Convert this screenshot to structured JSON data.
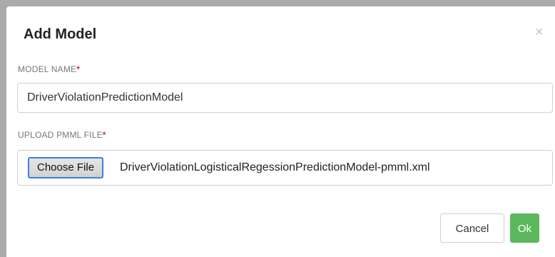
{
  "modal": {
    "title": "Add Model",
    "close_glyph": "×"
  },
  "form": {
    "model_name_label": "MODEL NAME",
    "model_name_required": "*",
    "model_name_value": "DriverViolationPredictionModel",
    "upload_label": "UPLOAD PMML FILE",
    "upload_required": "*",
    "choose_file_label": "Choose File",
    "selected_file_name": "DriverViolationLogisticalRegessionPredictionModel-pmml.xml"
  },
  "footer": {
    "cancel_label": "Cancel",
    "ok_label": "Ok"
  },
  "colors": {
    "ok_button": "#5cb85c",
    "required_marker": "#d32f2f",
    "focus_border": "#3b82e0"
  }
}
